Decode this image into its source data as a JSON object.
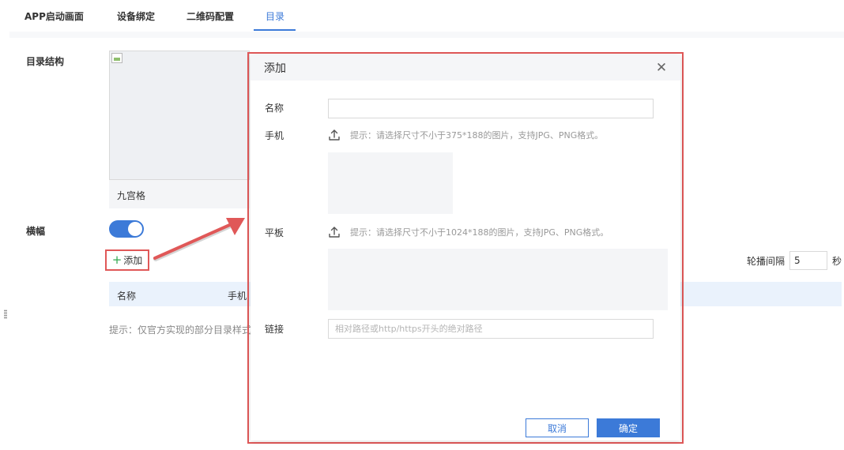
{
  "tabs": [
    {
      "label": "APP启动画面",
      "active": false
    },
    {
      "label": "设备绑定",
      "active": false
    },
    {
      "label": "二维码配置",
      "active": false
    },
    {
      "label": "目录",
      "active": true
    }
  ],
  "catalog": {
    "structure_label": "目录结构",
    "grid_name": "九宫格"
  },
  "banner": {
    "label": "横幅",
    "toggle_on": true,
    "add_label": "添加",
    "table_headers": [
      "名称",
      "手机"
    ],
    "hint": "提示：仅官方实现的部分目录样式"
  },
  "carousel": {
    "label": "轮播间隔",
    "value": "5",
    "unit": "秒"
  },
  "modal": {
    "title": "添加",
    "name_label": "名称",
    "name_value": "",
    "phone_label": "手机",
    "phone_hint": "提示：请选择尺寸不小于375*188的图片，支持JPG、PNG格式。",
    "tablet_label": "平板",
    "tablet_hint": "提示：请选择尺寸不小于1024*188的图片，支持JPG、PNG格式。",
    "link_label": "链接",
    "link_placeholder": "相对路径或http/https开头的绝对路径",
    "cancel_label": "取消",
    "ok_label": "确定"
  },
  "colors": {
    "accent": "#3c7ad8",
    "annotation_red": "#e05858",
    "plus_green": "#2fa84f"
  }
}
